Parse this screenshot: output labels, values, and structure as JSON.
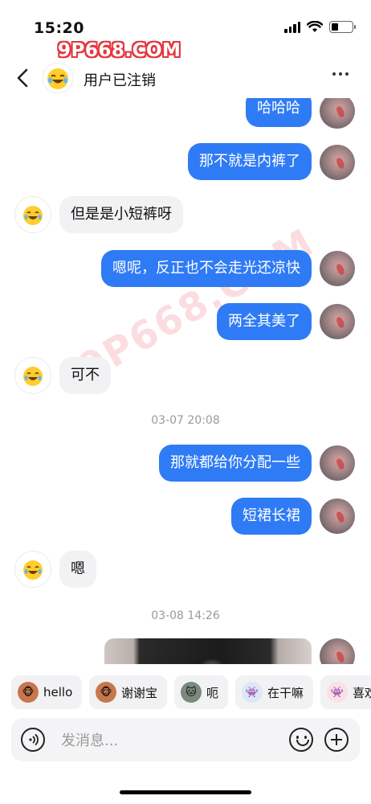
{
  "status_bar": {
    "time": "15:20"
  },
  "watermark_top": "9P668.COM",
  "header": {
    "title": "用户已注销"
  },
  "messages": [
    {
      "side": "right",
      "text": "哈哈哈"
    },
    {
      "side": "right",
      "text": "那不就是内裤了"
    },
    {
      "side": "left",
      "text": "但是是小短裤呀"
    },
    {
      "side": "right",
      "text": "嗯呢，反正也不会走光还凉快"
    },
    {
      "side": "right",
      "text": "两全其美了"
    },
    {
      "side": "left",
      "text": "可不"
    },
    {
      "side": "time",
      "text": "03-07 20:08"
    },
    {
      "side": "right",
      "text": "那就都给你分配一些"
    },
    {
      "side": "right",
      "text": "短裙长裙"
    },
    {
      "side": "left",
      "text": "嗯"
    },
    {
      "side": "time",
      "text": "03-08 14:26"
    }
  ],
  "quick_replies": [
    {
      "label": "hello",
      "icon": "monkey-icon"
    },
    {
      "label": "谢谢宝",
      "icon": "monkey-flower-icon"
    },
    {
      "label": "呃",
      "icon": "cat-icon"
    },
    {
      "label": "在干嘛",
      "icon": "monster-icon"
    },
    {
      "label": "喜欢",
      "icon": "monster-pink-icon"
    }
  ],
  "input": {
    "placeholder": "发消息..."
  },
  "colors": {
    "accent": "#2f7bf5",
    "bubble_left": "#f2f2f4",
    "watermark": "#e4373f"
  }
}
